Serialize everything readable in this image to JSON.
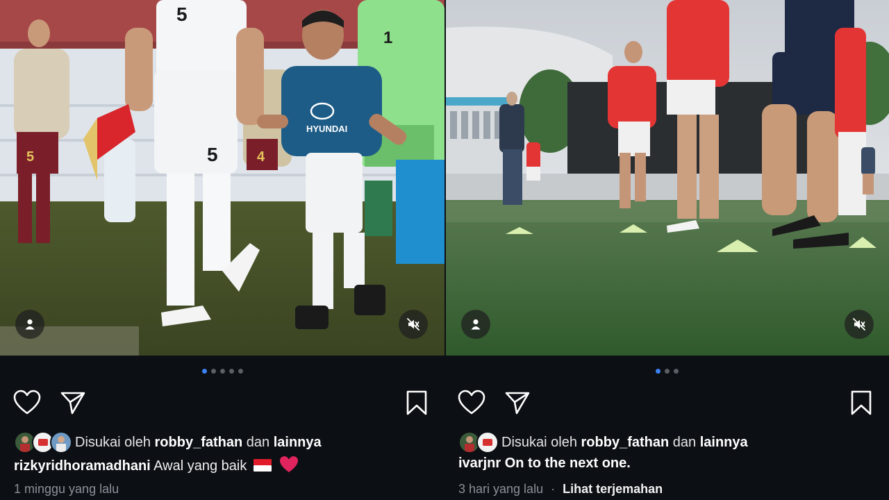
{
  "posts": [
    {
      "dots": [
        true,
        false,
        false,
        false,
        false
      ],
      "liked_prefix": "Disukai oleh",
      "liked_user": "robby_fathan",
      "liked_joiner": "dan",
      "liked_suffix": "lainnya",
      "username": "rizkyridhoramadhani",
      "caption": "Awal yang baik",
      "caption_emoji": "🇮🇩 ❤️",
      "time": "1 minggu yang lalu",
      "jersey_numbers": [
        "5",
        "5",
        "1",
        "5",
        "4"
      ],
      "sponsor": "HYUNDAI"
    },
    {
      "dots": [
        true,
        false,
        false
      ],
      "liked_prefix": "Disukai oleh",
      "liked_user": "robby_fathan",
      "liked_joiner": "dan",
      "liked_suffix": "lainnya",
      "username": "ivarjnr",
      "caption": "On to the next one.",
      "time": "3 hari yang lalu",
      "separator": "·",
      "translate": "Lihat terjemahan"
    }
  ],
  "icons": {
    "like": "heart-icon",
    "share": "send-icon",
    "save": "bookmark-icon",
    "tag": "user-tag-icon",
    "mute": "speaker-muted-icon"
  },
  "colors": {
    "background": "#0c0f14",
    "active_dot": "#3b82f6",
    "inactive_dot": "#5b5f66",
    "heart": "#e0245e"
  }
}
